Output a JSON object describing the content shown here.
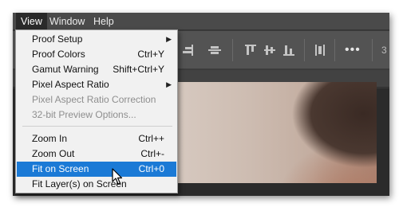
{
  "menubar": {
    "items": [
      {
        "label": "View",
        "active": true
      },
      {
        "label": "Window"
      },
      {
        "label": "Help"
      }
    ]
  },
  "toolbar": {
    "icons": [
      "align-right-edges-icon",
      "align-horizontal-centers-icon",
      "align-top-edges-icon",
      "align-vertical-centers-icon",
      "align-bottom-edges-icon",
      "distribute-icon",
      "more-options-icon"
    ],
    "more_label": "•••",
    "partial_value": "3"
  },
  "view_menu": {
    "items": [
      {
        "label": "Proof Setup",
        "submenu": true,
        "arrow": "▶"
      },
      {
        "label": "Proof Colors",
        "shortcut": "Ctrl+Y"
      },
      {
        "label": "Gamut Warning",
        "shortcut": "Shift+Ctrl+Y"
      },
      {
        "label": "Pixel Aspect Ratio",
        "submenu": true,
        "arrow": "▶"
      },
      {
        "label": "Pixel Aspect Ratio Correction",
        "disabled": true
      },
      {
        "label": "32-bit Preview Options...",
        "disabled": true
      },
      {
        "label": "Zoom In",
        "shortcut": "Ctrl++"
      },
      {
        "label": "Zoom Out",
        "shortcut": "Ctrl+-"
      },
      {
        "label": "Fit on Screen",
        "shortcut": "Ctrl+0",
        "selected": true
      },
      {
        "label": "Fit Layer(s) on Screen"
      }
    ]
  },
  "colors": {
    "highlight": "#1b7ad6",
    "menu_bg": "#f1f1f1",
    "disabled_text": "#8e8e8e",
    "app_bg": "#535353"
  }
}
